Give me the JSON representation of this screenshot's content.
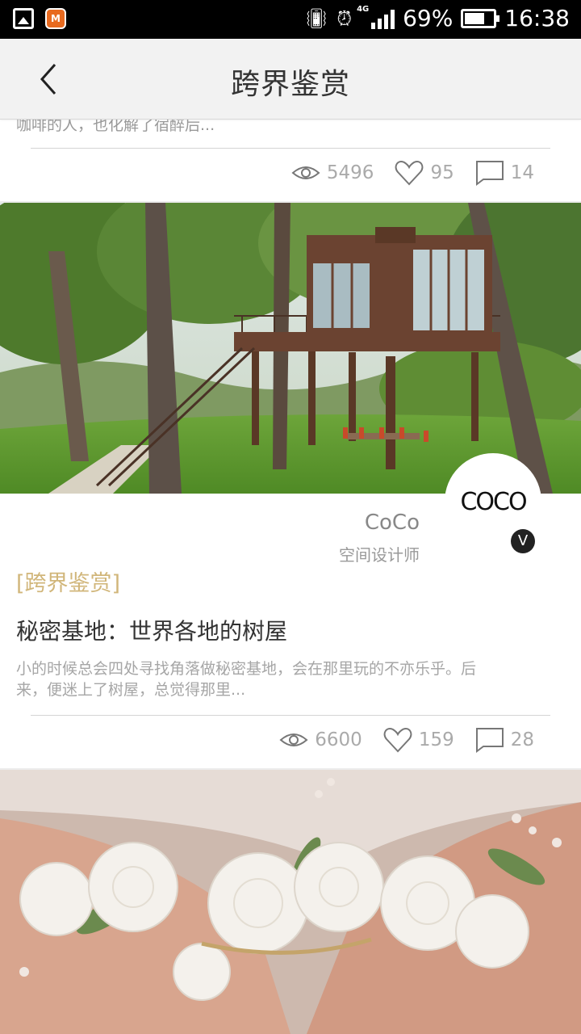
{
  "status_bar": {
    "battery_percent": "69%",
    "battery_level": 0.69,
    "time": "16:38",
    "network": "4G",
    "app_icon_text": "M"
  },
  "header": {
    "title": "跨界鉴赏"
  },
  "previous_card": {
    "excerpt_tail": "咖啡的人，也化解了宿醉后...",
    "views": "5496",
    "likes": "95",
    "comments": "14"
  },
  "card": {
    "author_logo": "COCO",
    "author_name": "CoCo",
    "author_role": "空间设计师",
    "verified_badge": "V",
    "tag": "[跨界鉴赏]",
    "title": "秘密基地：世界各地的树屋",
    "excerpt": "小的时候总会四处寻找角落做秘密基地，会在那里玩的不亦乐乎。后来，便迷上了树屋，总觉得那里...",
    "views": "6600",
    "likes": "159",
    "comments": "28"
  },
  "colors": {
    "tag": "#d1b67a",
    "header_bg": "#f2f2f2",
    "text_primary": "#333333",
    "text_muted": "#a6a6a6"
  }
}
